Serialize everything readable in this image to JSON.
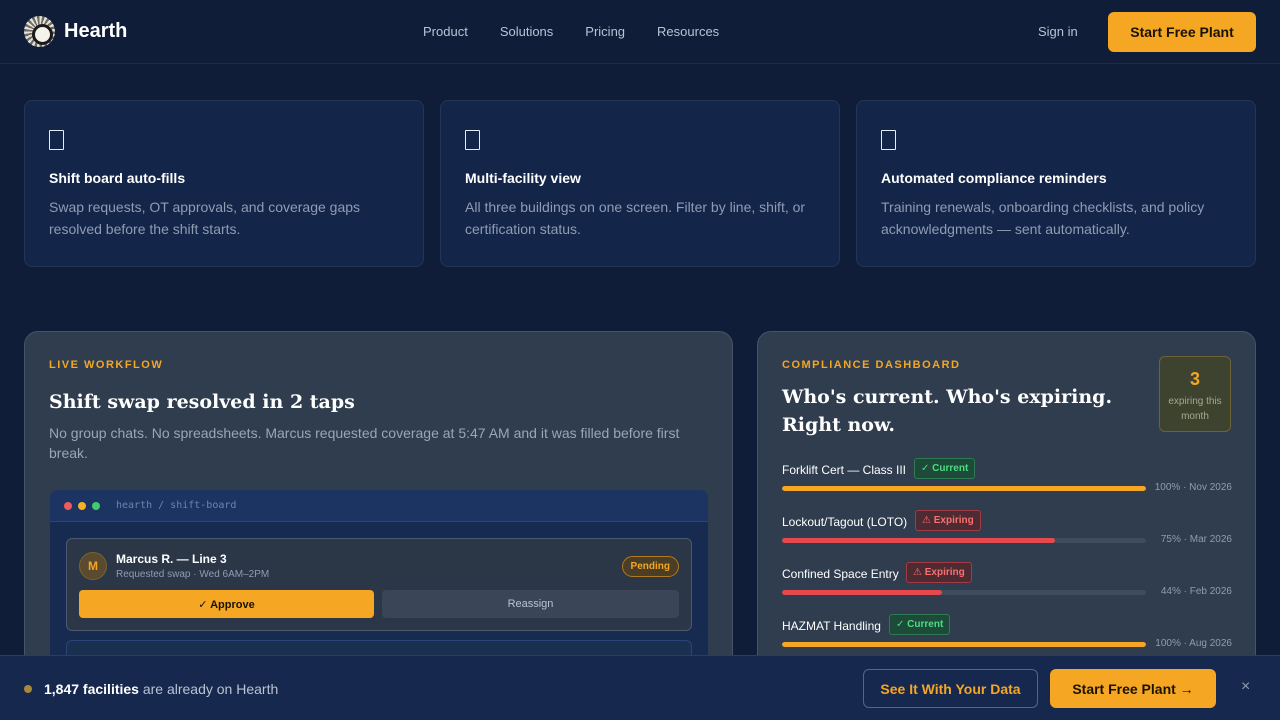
{
  "brand": {
    "name": "Hearth",
    "logo_icon": "hearth-logo-mark"
  },
  "nav": {
    "links": [
      "Product",
      "Solutions",
      "Pricing",
      "Resources"
    ],
    "sign_in": "Sign in",
    "cta": "Start Free Plant"
  },
  "features": [
    {
      "icon": "document-icon",
      "title": "Shift board auto-fills",
      "desc": "Swap requests, OT approvals, and coverage gaps resolved before the shift starts."
    },
    {
      "icon": "document-icon",
      "title": "Multi-facility view",
      "desc": "All three buildings on one screen. Filter by line, shift, or certification status."
    },
    {
      "icon": "document-icon",
      "title": "Automated compliance reminders",
      "desc": "Training renewals, onboarding checklists, and policy acknowledgments — sent automatically."
    }
  ],
  "workflow": {
    "eyebrow": "LIVE WORKFLOW",
    "title": "Shift swap resolved in 2 taps",
    "desc": "No group chats. No spreadsheets. Marcus requested coverage at 5:47 AM and it was filled before first break.",
    "mock": {
      "path": "hearth / shift-board",
      "request": {
        "avatar": "M",
        "name": "Marcus R. — Line 3",
        "sub": "Requested swap · Wed 6AM–2PM",
        "status": "Pending",
        "approve": "✓ Approve",
        "reassign": "Reassign"
      }
    }
  },
  "compliance": {
    "eyebrow": "COMPLIANCE DASHBOARD",
    "title": "Who's current. Who's expiring. Right now.",
    "badge": {
      "count": "3",
      "label": "expiring this month"
    },
    "certs": [
      {
        "name": "Forklift Cert — Class III",
        "status": "✓ Current",
        "state": "current",
        "percent": 100,
        "meta": "100% · Nov 2026"
      },
      {
        "name": "Lockout/Tagout (LOTO)",
        "status": "⚠ Expiring",
        "state": "expiring",
        "percent": 75,
        "meta": "75% · Mar 2026"
      },
      {
        "name": "Confined Space Entry",
        "status": "⚠ Expiring",
        "state": "expiring",
        "percent": 44,
        "meta": "44% · Feb 2026"
      },
      {
        "name": "HAZMAT Handling",
        "status": "✓ Current",
        "state": "current",
        "percent": 100,
        "meta": "100% · Aug 2026"
      }
    ],
    "colors": {
      "current": "#f5a623",
      "expiring": "#e5484d"
    }
  },
  "bottom_bar": {
    "count": "1,847 facilities",
    "text": " are already on Hearth",
    "see_data": "See It With Your Data",
    "start": "Start Free Plant →",
    "close": "×"
  }
}
